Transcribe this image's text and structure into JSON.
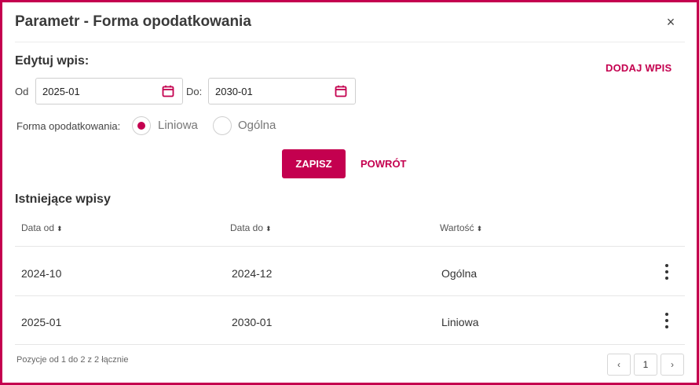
{
  "dialog": {
    "title": "Parametr - Forma opodatkowania",
    "close_label": "×"
  },
  "edit": {
    "heading": "Edytuj wpis:",
    "add_label": "DODAJ WPIS",
    "from_label": "Od",
    "from_value": "2025-01",
    "to_label": "Do:",
    "to_value": "2030-01",
    "tax_form_label": "Forma opodatkowania:",
    "options": [
      {
        "label": "Liniowa",
        "selected": true
      },
      {
        "label": "Ogólna",
        "selected": false
      }
    ],
    "save_label": "ZAPISZ",
    "back_label": "POWRÓT"
  },
  "existing": {
    "heading": "Istniejące wpisy",
    "columns": [
      "Data od",
      "Data do",
      "Wartość"
    ],
    "sort_icon": "⬍",
    "rows": [
      {
        "from": "2024-10",
        "to": "2024-12",
        "value": "Ogólna"
      },
      {
        "from": "2025-01",
        "to": "2030-01",
        "value": "Liniowa"
      }
    ]
  },
  "pagination": {
    "info": "Pozycje od 1 do 2 z 2 łącznie",
    "prev": "‹",
    "page": "1",
    "next": "›"
  },
  "colors": {
    "accent": "#c4004f",
    "border": "#cfcfcf"
  },
  "icons": [
    "close-icon",
    "calendar-icon",
    "sort-icon",
    "kebab-menu-icon",
    "chevron-left-icon",
    "chevron-right-icon"
  ]
}
